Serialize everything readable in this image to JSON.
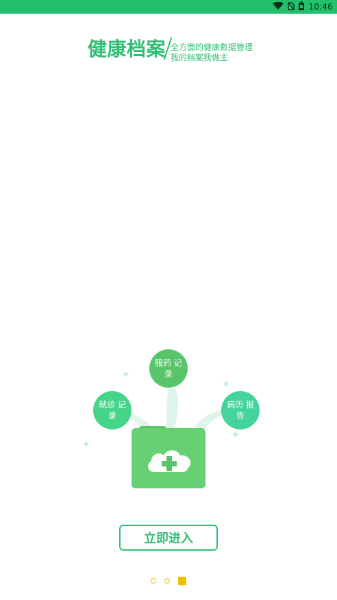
{
  "status_bar": {
    "time": "10:46",
    "icons": [
      "wifi-icon",
      "no-sim-icon",
      "battery-icon"
    ]
  },
  "header": {
    "title": "健康档案",
    "line1": "全方面的健康数据管理",
    "line2": "我的档案我做主"
  },
  "illustration": {
    "bubbles": [
      {
        "label": "服药 记录",
        "color": "#58c56b"
      },
      {
        "label": "就诊 记录",
        "color": "#46d489"
      },
      {
        "label": "病历 报告",
        "color": "#44d39a"
      }
    ]
  },
  "enter_button": {
    "label": "立即进入",
    "color": "#2fbf72"
  },
  "page_indicator": {
    "count": 3,
    "active_index": 3,
    "color": "#f0c000"
  },
  "colors": {
    "status_bar": "#22c06a",
    "accent": "#2fbf72"
  }
}
